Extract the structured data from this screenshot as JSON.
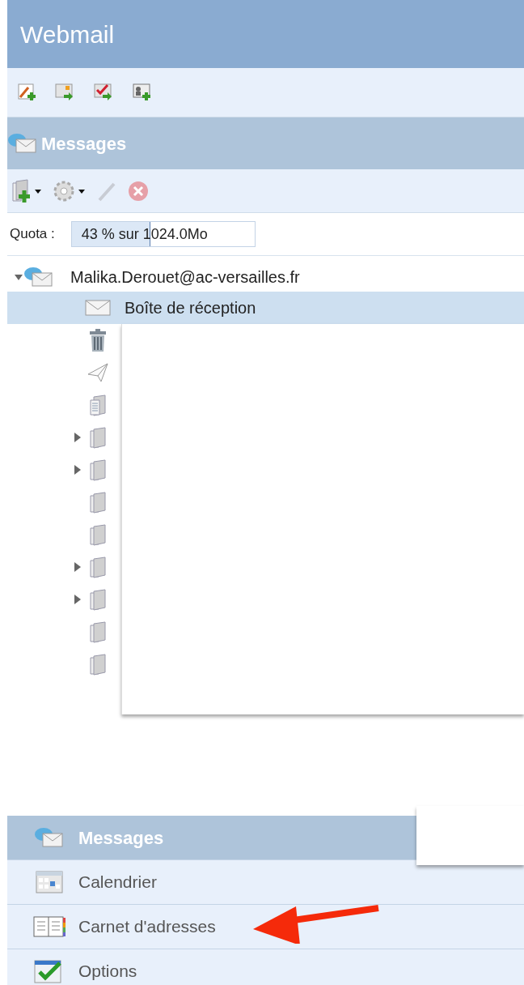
{
  "header": {
    "title": "Webmail"
  },
  "section": {
    "title": "Messages"
  },
  "quota": {
    "label": "Quota :",
    "reading": "43 % sur 1024.0Mo",
    "level": 0.43
  },
  "account": {
    "name": "Malika.Derouet@ac-versailles.fr",
    "expanded": true,
    "folders": [
      {
        "kind": "inbox",
        "name": "Boîte de réception",
        "selected": true,
        "expandable": false
      },
      {
        "kind": "trash",
        "selected": false,
        "expandable": false
      },
      {
        "kind": "sent",
        "selected": false,
        "expandable": false
      },
      {
        "kind": "drafts",
        "selected": false,
        "expandable": false
      },
      {
        "kind": "folder",
        "selected": false,
        "expandable": true
      },
      {
        "kind": "folder",
        "selected": false,
        "expandable": true
      },
      {
        "kind": "folder",
        "selected": false,
        "expandable": false
      },
      {
        "kind": "folder",
        "selected": false,
        "expandable": false
      },
      {
        "kind": "folder",
        "selected": false,
        "expandable": true
      },
      {
        "kind": "folder",
        "selected": false,
        "expandable": true
      },
      {
        "kind": "folder",
        "selected": false,
        "expandable": false
      },
      {
        "kind": "folder",
        "selected": false,
        "expandable": false
      }
    ]
  },
  "nav": [
    {
      "kind": "messages",
      "label": "Messages",
      "selected": true
    },
    {
      "kind": "calendar",
      "label": "Calendrier",
      "selected": false
    },
    {
      "kind": "contacts",
      "label": "Carnet d'adresses",
      "selected": false
    },
    {
      "kind": "options",
      "label": "Options",
      "selected": false
    }
  ]
}
